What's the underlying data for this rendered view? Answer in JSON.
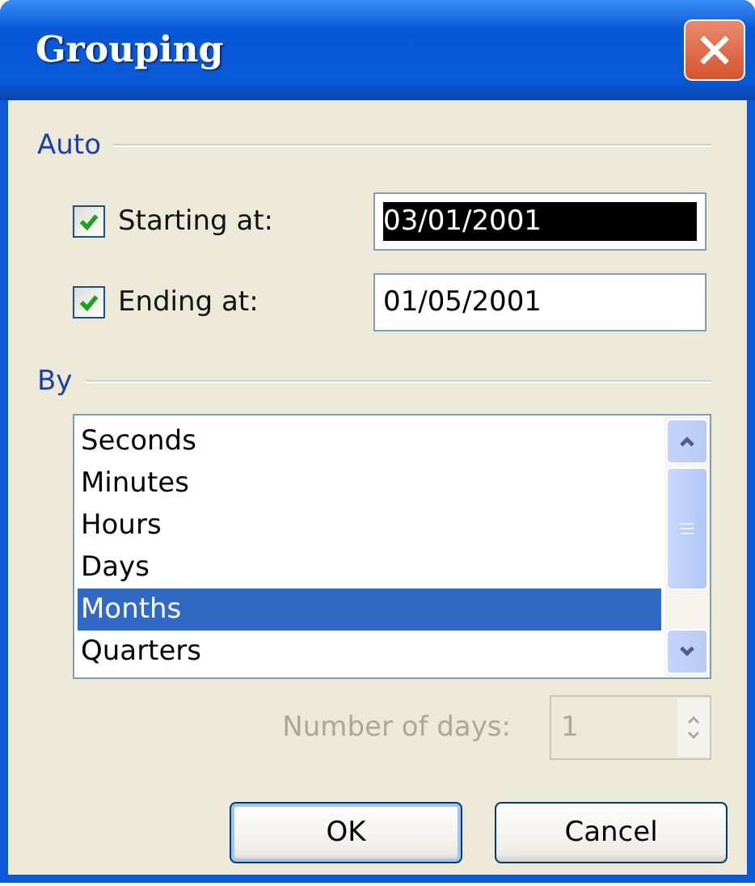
{
  "window": {
    "title": "Grouping"
  },
  "auto": {
    "label": "Auto",
    "fields": [
      {
        "label": "Starting at:",
        "checked": true,
        "value": "03/01/2001",
        "text_selected": true
      },
      {
        "label": "Ending at:",
        "checked": true,
        "value": "01/05/2001",
        "text_selected": false
      }
    ]
  },
  "by": {
    "label": "By",
    "items": [
      {
        "label": "Seconds",
        "selected": false
      },
      {
        "label": "Minutes",
        "selected": false
      },
      {
        "label": "Hours",
        "selected": false
      },
      {
        "label": "Days",
        "selected": false
      },
      {
        "label": "Months",
        "selected": true
      },
      {
        "label": "Quarters",
        "selected": false
      }
    ]
  },
  "number_of_days": {
    "label": "Number of days:",
    "value": "1",
    "disabled": true
  },
  "buttons": [
    {
      "label": "OK",
      "default": true
    },
    {
      "label": "Cancel",
      "default": false
    }
  ]
}
